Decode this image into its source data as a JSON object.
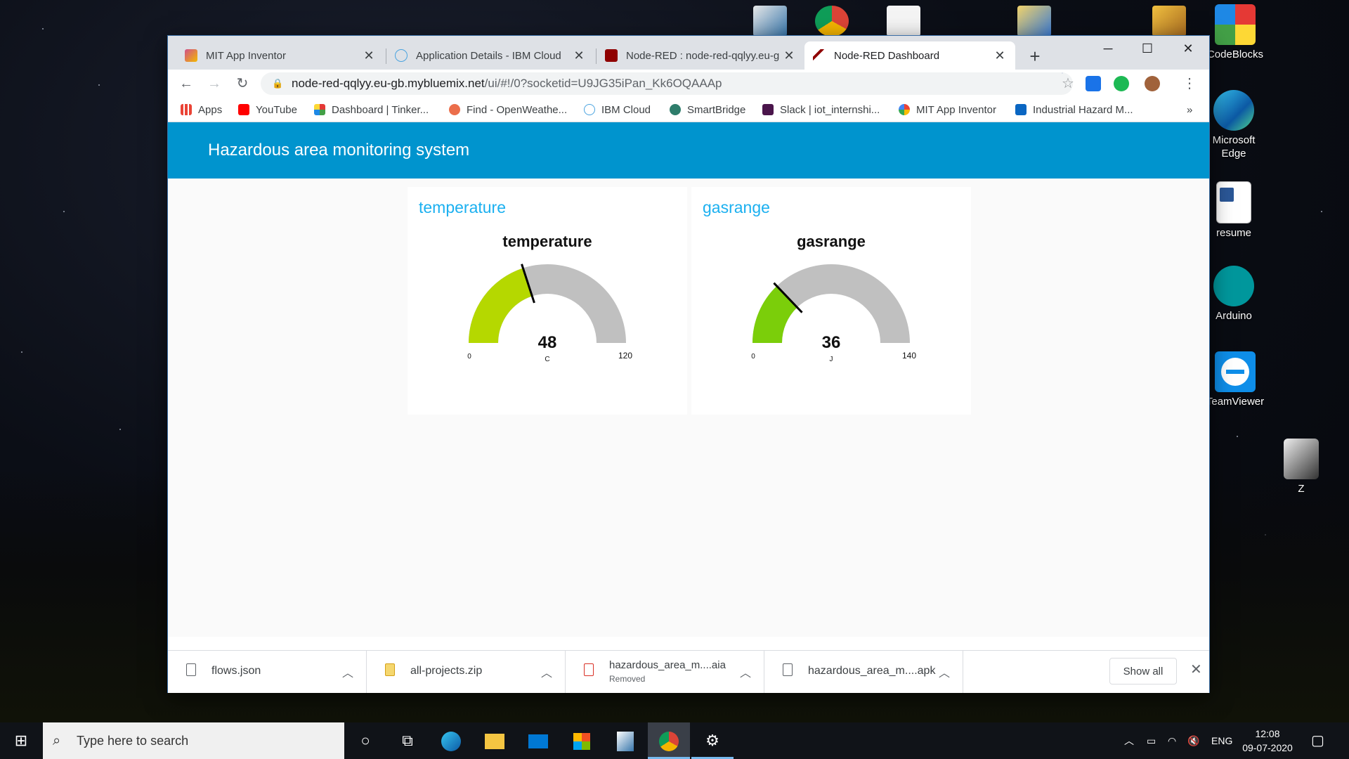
{
  "desktop": {
    "icons": [
      {
        "label": "CodeBlocks",
        "icon": "codeblocks-icon"
      },
      {
        "label": "Microsoft Edge",
        "icon": "edge-icon"
      },
      {
        "label": "resume",
        "icon": "word-document-icon"
      },
      {
        "label": "Arduino",
        "icon": "arduino-icon"
      },
      {
        "label": "TeamViewer",
        "icon": "teamviewer-icon"
      },
      {
        "label": "Z",
        "icon": "phone-icon"
      }
    ]
  },
  "browser": {
    "tabs": [
      {
        "title": "MIT App Inventor",
        "close": "✕"
      },
      {
        "title": "Application Details - IBM Cloud",
        "close": "✕"
      },
      {
        "title": "Node-RED : node-red-qqlyy.eu-g",
        "close": "✕"
      },
      {
        "title": "Node-RED Dashboard",
        "close": "✕"
      }
    ],
    "new_tab": "+",
    "url_host": "node-red-qqlyy.eu-gb.mybluemix.net",
    "url_rest": "/ui/#!/0?socketid=U9JG35iPan_Kk6OQAAAp",
    "bookmarks": [
      {
        "label": "Apps"
      },
      {
        "label": "YouTube"
      },
      {
        "label": "Dashboard | Tinker..."
      },
      {
        "label": "Find - OpenWeathe..."
      },
      {
        "label": "IBM Cloud"
      },
      {
        "label": "SmartBridge"
      },
      {
        "label": "Slack | iot_internshi..."
      },
      {
        "label": "MIT App Inventor"
      },
      {
        "label": "Industrial Hazard M..."
      }
    ],
    "bookmarks_more": "»"
  },
  "dashboard": {
    "title": "Hazardous area monitoring system",
    "header_color": "#0094ce",
    "gauges": [
      {
        "group": "temperature",
        "label": "temperature",
        "value": 48,
        "min": 0,
        "max": 120,
        "unit": "C",
        "fill_color": "#b5d800"
      },
      {
        "group": "gasrange",
        "label": "gasrange",
        "value": 36,
        "min": 0,
        "max": 140,
        "unit": "J",
        "fill_color": "#7bce0a"
      }
    ]
  },
  "downloads": {
    "items": [
      {
        "name": "flows.json",
        "status": ""
      },
      {
        "name": "all-projects.zip",
        "status": ""
      },
      {
        "name": "hazardous_area_m....aia",
        "status": "Removed"
      },
      {
        "name": "hazardous_area_m....apk",
        "status": ""
      }
    ],
    "show_all": "Show all"
  },
  "taskbar": {
    "search_placeholder": "Type here to search",
    "language": "ENG",
    "time": "12:08",
    "date": "09-07-2020"
  }
}
